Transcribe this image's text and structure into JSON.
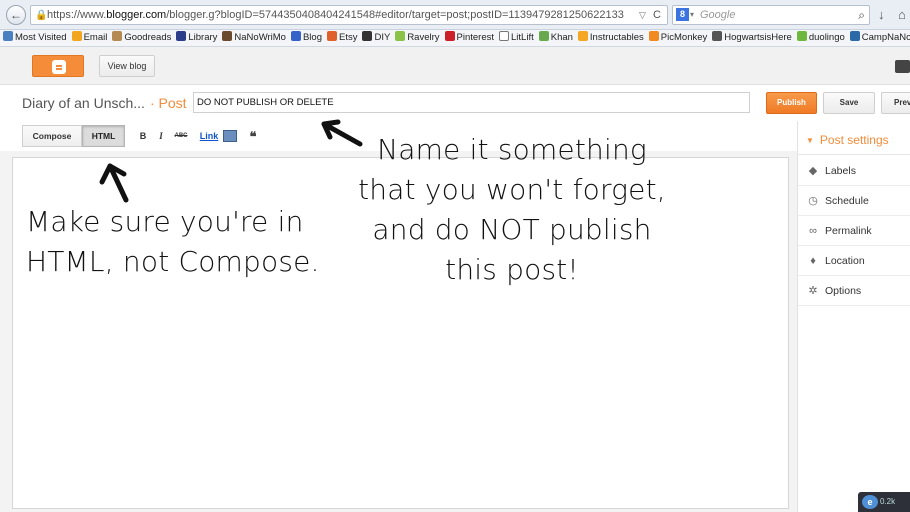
{
  "browser": {
    "url_prefix": "https://www.",
    "url_host": "blogger.com",
    "url_rest": "/blogger.g?blogID=5744350408404241548#editor/target=post;postID=1139479281250622133",
    "search_placeholder": "Google",
    "search_engine_glyph": "8",
    "back_glyph": "←",
    "dropdown_glyph": "▽",
    "reload_glyph": "C",
    "search_glyph": "⌕",
    "download_glyph": "↓",
    "home_glyph": "⌂"
  },
  "bookmarks": [
    {
      "label": "Most Visited",
      "icon": "bookmark-star-icon",
      "color": "#4a7fc1"
    },
    {
      "label": "Email",
      "icon": "email-icon",
      "color": "#f2a51f"
    },
    {
      "label": "Goodreads",
      "icon": "goodreads-icon",
      "color": "#b58a52"
    },
    {
      "label": "Library",
      "icon": "library-icon",
      "color": "#2c3e8a"
    },
    {
      "label": "NaNoWriMo",
      "icon": "nanowrimo-icon",
      "color": "#6b4a2f"
    },
    {
      "label": "Blog",
      "icon": "blog-icon",
      "color": "#3563c9"
    },
    {
      "label": "Etsy",
      "icon": "etsy-icon",
      "color": "#e0602b"
    },
    {
      "label": "DIY",
      "icon": "diy-icon",
      "color": "#333333"
    },
    {
      "label": "Ravelry",
      "icon": "ravelry-icon",
      "color": "#8bc34a"
    },
    {
      "label": "Pinterest",
      "icon": "pinterest-icon",
      "color": "#cb2027"
    },
    {
      "label": "LitLift",
      "icon": "litlift-icon",
      "color": "#ffffff"
    },
    {
      "label": "Khan",
      "icon": "khan-icon",
      "color": "#6aa84f"
    },
    {
      "label": "Instructables",
      "icon": "instructables-icon",
      "color": "#f5a623"
    },
    {
      "label": "PicMonkey",
      "icon": "picmonkey-icon",
      "color": "#f18a21"
    },
    {
      "label": "HogwartsisHere",
      "icon": "hogwarts-icon",
      "color": "#555555"
    },
    {
      "label": "duolingo",
      "icon": "duolingo-icon",
      "color": "#6fb83f"
    },
    {
      "label": "CampNaNo",
      "icon": "campnano-icon",
      "color": "#2b6aa8"
    }
  ],
  "topbar": {
    "view_blog_label": "View blog"
  },
  "title_row": {
    "blog_title": "Diary of an Unsch...",
    "post_crumb": "· Post",
    "post_title_value": "DO NOT PUBLISH OR DELETE",
    "publish_label": "Publish",
    "save_label": "Save",
    "preview_label": "Preview"
  },
  "toolbar": {
    "compose_label": "Compose",
    "html_label": "HTML",
    "bold_label": "B",
    "italic_label": "I",
    "strike_label": "ABC",
    "link_label": "Link",
    "quote_label": "❝"
  },
  "sidebar": {
    "header": "Post settings",
    "items": [
      {
        "label": "Labels",
        "icon": "tag-icon",
        "glyph": "◆"
      },
      {
        "label": "Schedule",
        "icon": "clock-icon",
        "glyph": "◷"
      },
      {
        "label": "Permalink",
        "icon": "link-icon",
        "glyph": "∞"
      },
      {
        "label": "Location",
        "icon": "location-pin-icon",
        "glyph": "♦"
      },
      {
        "label": "Options",
        "icon": "gear-icon",
        "glyph": "✲"
      }
    ]
  },
  "annotations": {
    "name_note": "Name it something that you won't forget, and do NOT publish this post!",
    "html_note": "Make sure you're in HTML, not Compose."
  },
  "tray": {
    "ie_glyph": "e",
    "text": "0.2k"
  },
  "colors": {
    "accent": "#f48c3a"
  }
}
